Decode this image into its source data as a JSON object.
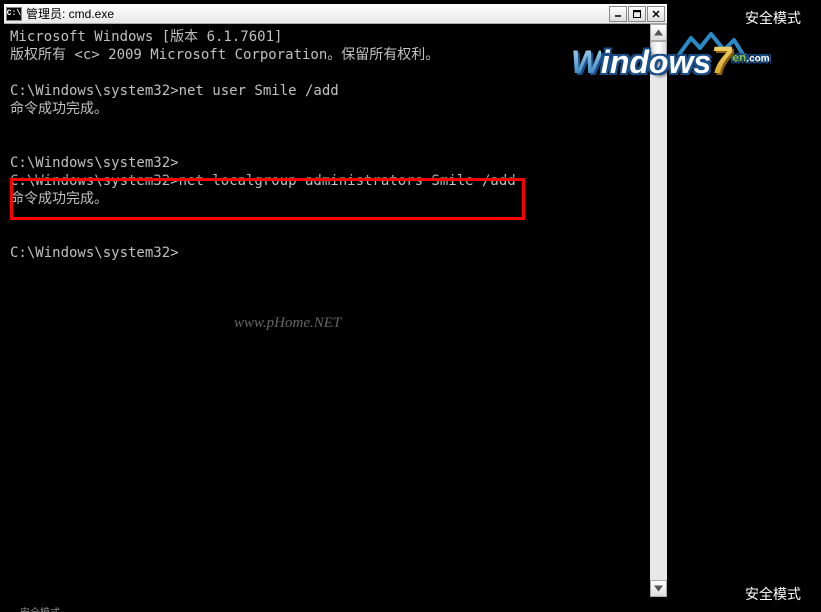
{
  "safe_mode_label": "安全模式",
  "window": {
    "title": "管理员: cmd.exe",
    "icon_text": "C:\\"
  },
  "terminal": {
    "line1": "Microsoft Windows [版本 6.1.7601]",
    "line2": "版权所有 <c> 2009 Microsoft Corporation。保留所有权利。",
    "line3": "",
    "line4": "C:\\Windows\\system32>net user Smile /add",
    "line5": "命令成功完成。",
    "line6": "",
    "line7": "",
    "line8": "C:\\Windows\\system32>",
    "line9": "C:\\Windows\\system32>net localgroup administrators Smile /add",
    "line10": "命令成功完成。",
    "line11": "",
    "line12": "",
    "line13": "C:\\Windows\\system32>"
  },
  "watermark": "www.pHome.NET",
  "logo": {
    "text_w": "W",
    "text_indows": "indows",
    "text_seven": "7",
    "text_en": "en",
    "text_com": ".com"
  }
}
